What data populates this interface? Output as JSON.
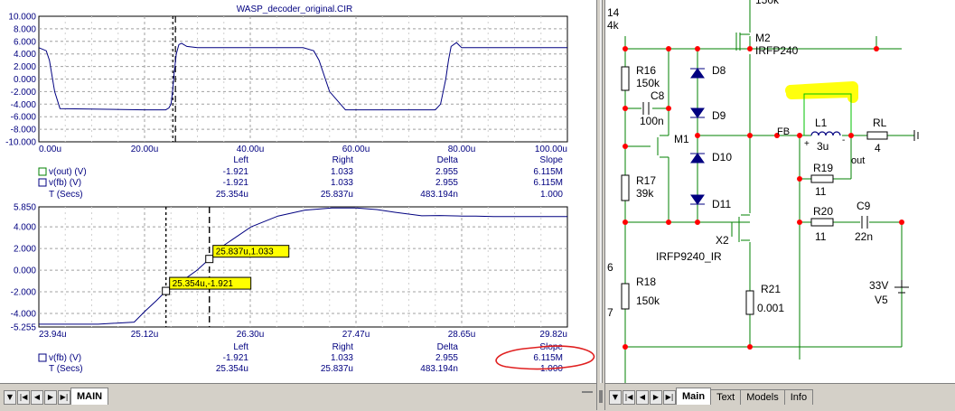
{
  "plot_title": "WASP_decoder_original.CIR",
  "chart_data": [
    {
      "type": "line",
      "xlim": [
        0,
        100
      ],
      "ylim": [
        -10,
        10
      ],
      "x_tick_labels": [
        "0.00u",
        "20.00u",
        "40.00u",
        "60.00u",
        "80.00u",
        "100.00u"
      ],
      "y_tick_labels": [
        "10.000",
        "8.000",
        "6.000",
        "4.000",
        "2.000",
        "0.000",
        "-2.000",
        "-4.000",
        "-6.000",
        "-8.000",
        "-10.000"
      ],
      "series": [
        {
          "name": "v(fb) (V)",
          "color": "#000080",
          "x": [
            0,
            1.4,
            2,
            3,
            4,
            20,
            24,
            24.6,
            25,
            25.3,
            25.6,
            26,
            26.5,
            27,
            28,
            30,
            50,
            52,
            53,
            55,
            58,
            70,
            75,
            76,
            77,
            77.5,
            78,
            79,
            80,
            100
          ],
          "y": [
            5,
            4.5,
            3,
            -2,
            -4.7,
            -4.9,
            -4.9,
            -4.6,
            -4,
            -2,
            1,
            4,
            5.5,
            5.7,
            5.2,
            5.0,
            5.0,
            4.5,
            3,
            -2,
            -4.9,
            -4.9,
            -4.9,
            -4,
            0,
            3,
            5.2,
            5.8,
            5.0,
            5.0
          ]
        }
      ],
      "cursor_lines": [
        25.354,
        25.837
      ],
      "grid": true
    },
    {
      "type": "line",
      "xlim": [
        23.94,
        29.82
      ],
      "ylim": [
        -5.255,
        5.85
      ],
      "x_tick_labels": [
        "23.94u",
        "25.12u",
        "26.30u",
        "27.47u",
        "28.65u",
        "29.82u"
      ],
      "y_tick_labels": [
        "5.850",
        "4.000",
        "2.000",
        "0.000",
        "-2.000",
        "-4.000",
        "-5.255"
      ],
      "series": [
        {
          "name": "v(fb) (V)",
          "color": "#000080",
          "x": [
            23.94,
            24.6,
            25.0,
            25.12,
            25.25,
            25.354,
            25.5,
            25.7,
            25.837,
            26.0,
            26.3,
            26.6,
            26.9,
            27.2,
            27.47,
            27.7,
            27.9,
            28.2,
            28.4,
            28.65,
            28.8,
            29.0,
            29.82
          ],
          "y": [
            -5.0,
            -5.0,
            -4.8,
            -3.8,
            -2.8,
            -1.921,
            -1.2,
            0.0,
            1.033,
            2.3,
            4.0,
            5.0,
            5.55,
            5.75,
            5.75,
            5.6,
            5.35,
            5.02,
            5.05,
            5.0,
            5.0,
            4.95,
            4.95
          ]
        }
      ],
      "cursor_lines": [
        25.354,
        25.837
      ],
      "cursor_labels": [
        "25.354u,-1.921",
        "25.837u,1.033"
      ],
      "grid": true
    }
  ],
  "table1": {
    "headers": [
      "Left",
      "Right",
      "Delta",
      "Slope"
    ],
    "rows": [
      {
        "name": "v(out) (V)",
        "values": [
          "-1.921",
          "1.033",
          "2.955",
          "6.115M"
        ]
      },
      {
        "name": "v(fb) (V)",
        "values": [
          "-1.921",
          "1.033",
          "2.955",
          "6.115M"
        ]
      },
      {
        "name": "T (Secs)",
        "values": [
          "25.354u",
          "25.837u",
          "483.194n",
          "1.000"
        ]
      }
    ]
  },
  "table2": {
    "headers": [
      "Left",
      "Right",
      "Delta",
      "Slope"
    ],
    "rows": [
      {
        "name": "v(fb) (V)",
        "values": [
          "-1.921",
          "1.033",
          "2.955",
          "6.115M"
        ]
      },
      {
        "name": "T (Secs)",
        "values": [
          "25.354u",
          "25.837u",
          "483.194n",
          "1.000"
        ]
      }
    ]
  },
  "left_tabs": [
    "MAIN"
  ],
  "right_tabs": [
    "Main",
    "Text",
    "Models",
    "Info"
  ],
  "schematic": {
    "labels": {
      "r16": "R16",
      "r16v": "150k",
      "c8": "C8",
      "c8v": "100n",
      "m1": "M1",
      "r17": "R17",
      "r17v": "39k",
      "r18": "R18",
      "r18v": "150k",
      "d8": "D8",
      "d9": "D9",
      "d10": "D10",
      "d11": "D11",
      "m2": "M2",
      "m2v": "IRFP240",
      "x2": "X2",
      "x2v": "IRFP9240_IR",
      "r21": "R21",
      "r21v": "0.001",
      "fb": "FB",
      "l1": "L1",
      "l1v": "3u",
      "plus": "+",
      "minus": "-",
      "out": "out",
      "rl": "RL",
      "rlv": "4",
      "r19": "R19",
      "r19v": "11",
      "r20": "R20",
      "r20v": "11",
      "c9": "C9",
      "c9v": "22n",
      "v5": "V5",
      "v5v": "33V",
      "p14": "14",
      "pk": "4k",
      "p50k": "150k",
      "p6": "6",
      "p7": "7"
    }
  },
  "colors": {
    "trace": "#000080",
    "wire": "#008000",
    "node": "#ff0000",
    "cursor_fill": "#ffff00",
    "annotation": "#e02020"
  }
}
